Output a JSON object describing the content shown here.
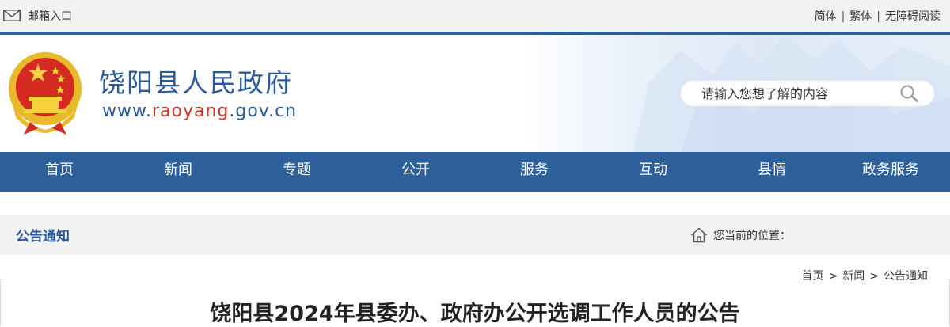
{
  "topbar": {
    "mail_label": "邮箱入口",
    "lang_simplified": "简体",
    "lang_traditional": "繁体",
    "accessibility": "无障碍阅读",
    "separator": "|"
  },
  "header": {
    "site_title": "饶阳县人民政府",
    "domain_prefix": "www.",
    "domain_highlight": "raoyang",
    "domain_suffix": ".gov.cn",
    "search_placeholder": "请输入您想了解的内容"
  },
  "nav": {
    "items": [
      {
        "label": "首页"
      },
      {
        "label": "新闻"
      },
      {
        "label": "专题"
      },
      {
        "label": "公开"
      },
      {
        "label": "服务"
      },
      {
        "label": "互动"
      },
      {
        "label": "县情"
      },
      {
        "label": "政务服务"
      }
    ]
  },
  "section": {
    "title": "公告通知",
    "location_label": "您当前的位置："
  },
  "breadcrumb": {
    "items": [
      "首页",
      "新闻",
      "公告通知"
    ],
    "separator": ">"
  },
  "article": {
    "title": "饶阳县2024年县委办、政府办公开选调工作人员的公告"
  },
  "colors": {
    "brand_blue": "#2d5f9b",
    "accent_red": "#d0322a",
    "topbar_bg": "#f2f2f2"
  },
  "icons": {
    "mail": "mail-icon",
    "emblem": "national-emblem",
    "search": "search-icon",
    "home": "home-icon"
  }
}
